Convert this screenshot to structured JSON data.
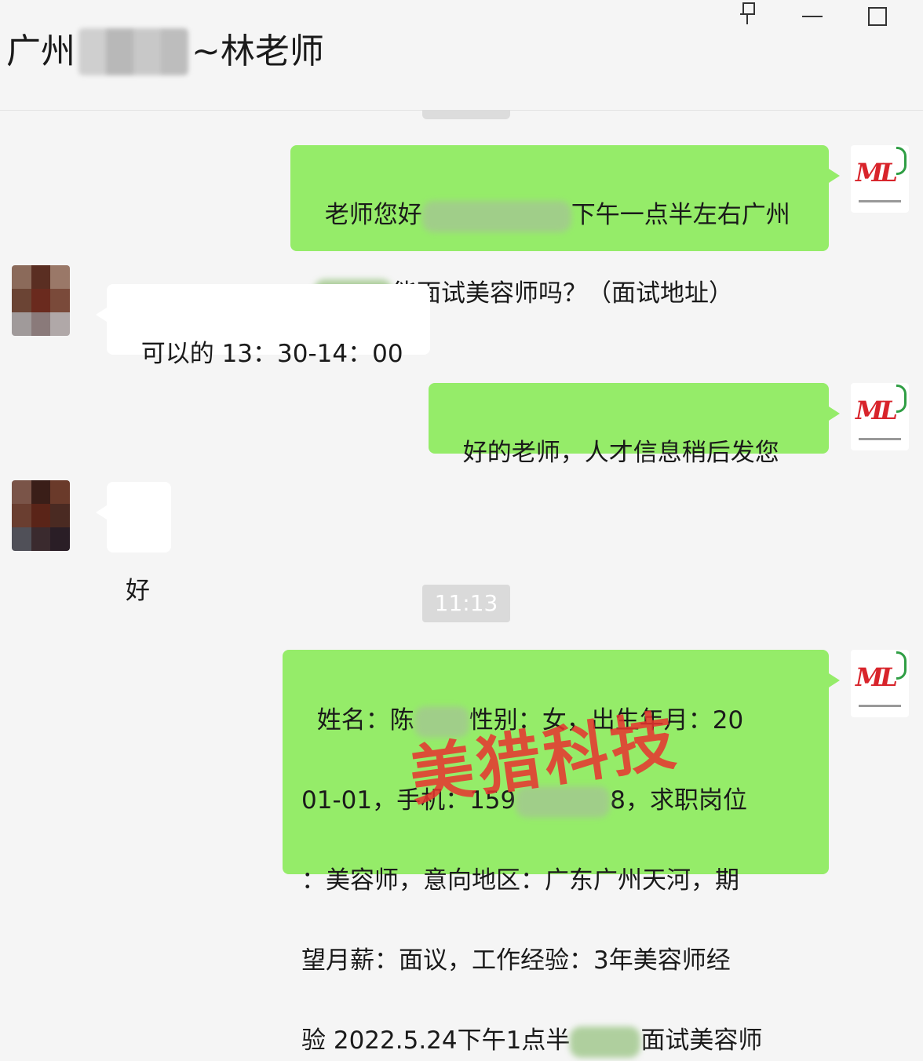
{
  "header": {
    "title_prefix": "广州",
    "title_suffix": "~林老师"
  },
  "window_controls": {
    "pin": "pin-icon",
    "minimize": "minimize-icon",
    "maximize": "maximize-icon"
  },
  "messages": [
    {
      "sender": "me",
      "line1_start": "老师您好",
      "line1_end": "下午一点半左右广州",
      "line2_end": "能面试美容师吗？（面试地址）"
    },
    {
      "sender": "them",
      "text": "可以的 13：30-14：00"
    },
    {
      "sender": "me",
      "text": "好的老师，人才信息稍后发您"
    },
    {
      "sender": "them",
      "text": "好"
    },
    {
      "sender": "me",
      "line1_a": "姓名：陈",
      "line1_b": "性别：女，出生年月：20",
      "line2_a": "01-01，手机：159",
      "line2_b": "8，求职岗位",
      "line3": "：美容师，意向地区：广东广州天河，期",
      "line4": "望月薪：面议，工作经验：3年美容师经",
      "line5_a": "验 2022.5.24下午1点半",
      "line5_b": "面试美容师"
    }
  ],
  "timestamp": "11:13",
  "watermark": "美猎科技",
  "colors": {
    "my_bubble": "#95ec69",
    "their_bubble": "#ffffff",
    "background": "#f5f5f5",
    "watermark": "#e8332f"
  }
}
